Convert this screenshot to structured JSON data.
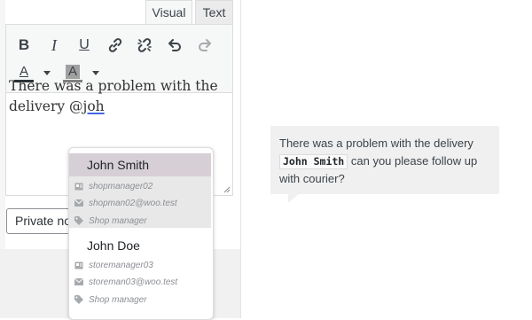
{
  "tabs": {
    "visual": "Visual",
    "text": "Text"
  },
  "toolbar": {
    "bold": "B",
    "italic": "I",
    "underline": "U",
    "text_color_letter": "A",
    "bg_color_letter": "A"
  },
  "editor": {
    "text_before": "There was a problem with the delivery @",
    "mention_typed": "joh"
  },
  "note_type": {
    "selected": "Private note"
  },
  "mention_popup": {
    "users": [
      {
        "name": "John Smith",
        "username": "shopmanager02",
        "email": "shopman02@woo.test",
        "role": "Shop manager",
        "selected": true
      },
      {
        "name": "John Doe",
        "username": "storemanager03",
        "email": "storeman03@woo.test",
        "role": "Shop manager",
        "selected": false
      }
    ]
  },
  "note_preview": {
    "text_before": "There was a problem with the delivery",
    "mention": "John Smith",
    "text_after": "can you please follow up with courier?"
  },
  "colors": {
    "selected_row": "#d7cfd6",
    "mention_underline": "#4169e1"
  }
}
